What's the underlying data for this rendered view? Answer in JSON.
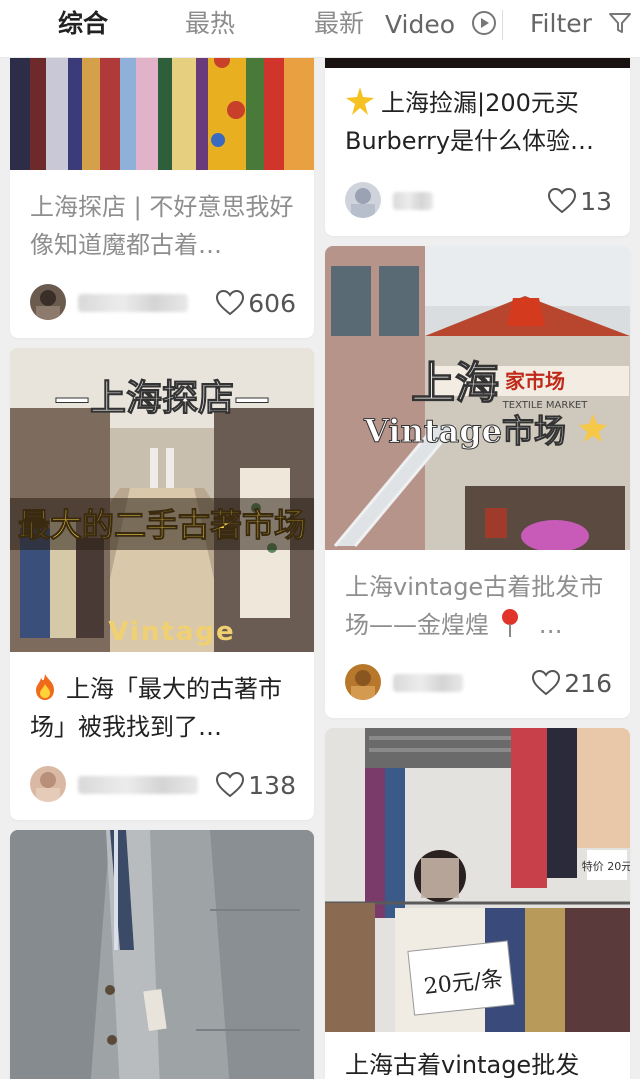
{
  "tabs": {
    "zonghe": "综合",
    "zuire": "最热",
    "zuixin": "最新",
    "video": "Video",
    "filter": "Filter"
  },
  "icons": {
    "video": "play-circle-icon",
    "filter": "funnel-icon",
    "like": "heart-outline-icon",
    "sparkle": "sparkle-emoji",
    "fire": "fire-emoji",
    "pin": "red-pin-emoji"
  },
  "colors": {
    "active_tab": "#222222",
    "inactive_tab": "#8c8c8c",
    "background": "#efefef",
    "card": "#ffffff"
  },
  "cards": [
    {
      "title": "上海探店 | 不好意思我好像知道魔都古着…",
      "likes": "606"
    },
    {
      "cover_text_top": "—上海探店—",
      "cover_text_mid": "最大的二手古著市场",
      "cover_text_bottom": "Vintage",
      "title": "上海「最大的古著市场」被我找到了…",
      "likes": "138"
    },
    {
      "title": "",
      "likes": ""
    },
    {
      "title": "上海捡漏|200元买Burberry是什么体验…",
      "likes": "13"
    },
    {
      "cover_text_sign_cn": "家市场",
      "cover_text_sign_en": "TEXTILE MARKET",
      "cover_text_top": "上海",
      "cover_text_mid": "Vintage市场",
      "title": "上海vintage古着批发市场——金煌煌",
      "likes": "216"
    },
    {
      "cover_text_sign": "20元/条",
      "cover_text_corner": "特价 20元",
      "title": "上海古着vintage批发",
      "likes": ""
    }
  ]
}
